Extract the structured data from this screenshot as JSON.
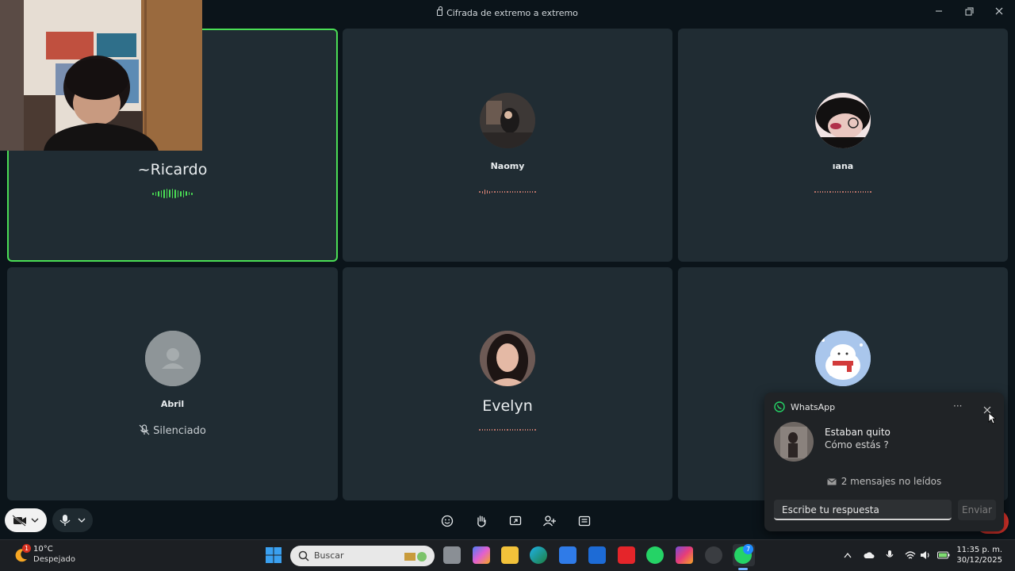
{
  "window": {
    "title": "Cifrada de extremo a extremo",
    "controls": [
      "minimize",
      "maximize",
      "close"
    ]
  },
  "participants": [
    {
      "name": "~Ricardo",
      "status": "speaking"
    },
    {
      "name": "Naomy",
      "status": "audio"
    },
    {
      "name": "ıana",
      "status": "audio"
    },
    {
      "name": "Abril",
      "status": "muted",
      "muted_label": "Silenciado"
    },
    {
      "name": "Evelyn",
      "status": "audio"
    },
    {
      "name": "",
      "status": "audio"
    }
  ],
  "colors": {
    "accent": "#4ade55",
    "tile_bg": "#202c33",
    "page_bg": "#0b141a",
    "whatsapp": "#25d366",
    "wave_active": "#4ade55",
    "wave_idle": "#e88a7a"
  },
  "call_toolbar": {
    "camera_icon": "camera-off-icon",
    "mic_icon": "microphone-icon",
    "actions": [
      "emoji-icon",
      "raise-hand-icon",
      "screen-share-icon",
      "add-participant-icon",
      "more-options-icon"
    ]
  },
  "notification": {
    "app": "WhatsApp",
    "sender": "Estaban quito",
    "message": "Cómo estás ?",
    "unread": "2 mensajes no leídos",
    "reply_placeholder": "Escribe tu respuesta",
    "send_label": "Enviar"
  },
  "taskbar": {
    "weather_temp": "10°C",
    "weather_condition": "Despejado",
    "weather_badge": "1",
    "search_placeholder": "Buscar",
    "whatsapp_badge": "7",
    "time": "11:35 p. m.",
    "date": "30/12/2025"
  }
}
